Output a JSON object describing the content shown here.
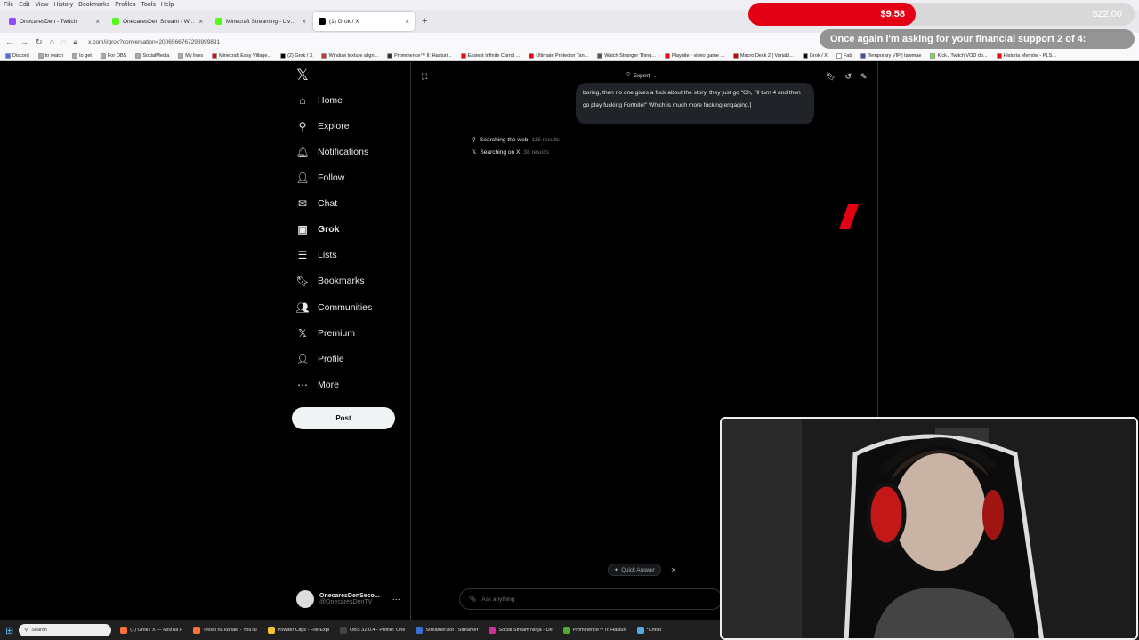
{
  "menubar": [
    "File",
    "Edit",
    "View",
    "History",
    "Bookmarks",
    "Profiles",
    "Tools",
    "Help"
  ],
  "tabs": [
    {
      "label": "OnecaresDen - Twitch",
      "color": "#9146ff",
      "active": false
    },
    {
      "label": "OnecaresDen Stream - Watch Li",
      "color": "#53fc18",
      "active": false
    },
    {
      "label": "Minecraft Streaming - Live Stre",
      "color": "#53fc18",
      "active": false
    },
    {
      "label": "(1) Grok / X",
      "color": "#000000",
      "active": true
    }
  ],
  "new_tab": "+",
  "url": "x.com/i/grok?conversation=2006566767296999891",
  "bookmarks": [
    {
      "label": "Discord",
      "color": "#5865f2"
    },
    {
      "label": "to watch",
      "color": "#aaaaaa"
    },
    {
      "label": "to get",
      "color": "#aaaaaa"
    },
    {
      "label": "For OBS",
      "color": "#aaaaaa"
    },
    {
      "label": "SocialMedia",
      "color": "#aaaaaa"
    },
    {
      "label": "My lives",
      "color": "#aaaaaa"
    },
    {
      "label": "Minecraft Easy Village...",
      "color": "#ff0000"
    },
    {
      "label": "(2) Grok / X",
      "color": "#000000"
    },
    {
      "label": "Window texture align...",
      "color": "#cc3333"
    },
    {
      "label": "Prominence™ II: Hasturi...",
      "color": "#333333"
    },
    {
      "label": "Easiest Infinite Carrot ...",
      "color": "#ff0000"
    },
    {
      "label": "Ultimate Protector Tan...",
      "color": "#ff0000"
    },
    {
      "label": "Watch Stranger Thing...",
      "color": "#555555"
    },
    {
      "label": "Playnite - video game ...",
      "color": "#ff0000"
    },
    {
      "label": "Macro Deck 2 | Variabl...",
      "color": "#cc0000"
    },
    {
      "label": "Grok / X",
      "color": "#000000"
    },
    {
      "label": "Fab",
      "color": "#ffffff"
    },
    {
      "label": "Temporary VIP | tawmae",
      "color": "#3355aa"
    },
    {
      "label": "Kick / Twitch VOD do...",
      "color": "#53fc18"
    },
    {
      "label": "Historia Memów - PLS...",
      "color": "#ff0000"
    }
  ],
  "sidebar": {
    "items": [
      {
        "label": "Home",
        "icon": "home-icon",
        "glyph": "⌂"
      },
      {
        "label": "Explore",
        "icon": "search-icon",
        "glyph": "⚲"
      },
      {
        "label": "Notifications",
        "icon": "bell-icon",
        "glyph": "🔔︎"
      },
      {
        "label": "Follow",
        "icon": "add-person-icon",
        "glyph": "👤︎"
      },
      {
        "label": "Chat",
        "icon": "mail-icon",
        "glyph": "✉"
      },
      {
        "label": "Grok",
        "icon": "grok-icon",
        "glyph": "▣"
      },
      {
        "label": "Lists",
        "icon": "list-icon",
        "glyph": "☰"
      },
      {
        "label": "Bookmarks",
        "icon": "bookmark-icon",
        "glyph": "🔖︎"
      },
      {
        "label": "Communities",
        "icon": "people-icon",
        "glyph": "👥︎"
      },
      {
        "label": "Premium",
        "icon": "x-logo-icon",
        "glyph": "𝕏"
      },
      {
        "label": "Profile",
        "icon": "person-icon",
        "glyph": "👤︎"
      },
      {
        "label": "More",
        "icon": "more-circle-icon",
        "glyph": "⋯"
      }
    ],
    "post_label": "Post",
    "account_name": "OnecaresDenSeco...",
    "account_handle": "@OnecaresDenTV"
  },
  "grok": {
    "mode": "Expert",
    "message": "boring, then no one gives a fuck about the story, they just go \"Oh, I'll turn 4 and then go play fucking Fortnite!\" Which is much more fucking engaging.]",
    "searches": [
      {
        "label": "Searching the web",
        "count": "115 results"
      },
      {
        "label": "Searching on X",
        "count": "38 results"
      }
    ],
    "quick_answer": "Quick Answer",
    "ask_placeholder": "Ask anything"
  },
  "overlay": {
    "goal_current": "$9.58",
    "goal_target": "$22.00",
    "banner": "Once again i'm asking for your financial support 2 of 4:"
  },
  "taskbar": {
    "search": "Search",
    "apps": [
      {
        "label": "(1) Grok / X — Mozilla F",
        "color": "#ff7139"
      },
      {
        "label": "Treści na kanale - YouTu",
        "color": "#ff7139"
      },
      {
        "label": "Powder Clips - File Expl",
        "color": "#f4c430"
      },
      {
        "label": "OBS 32.0.4 - Profile: One",
        "color": "#444444"
      },
      {
        "label": "Streamer.bot - Streamer",
        "color": "#3a6fd8"
      },
      {
        "label": "Social Stream Ninja - De",
        "color": "#cc3399"
      },
      {
        "label": "Prominence™ II: Hasturi",
        "color": "#55aa33"
      },
      {
        "label": "*Christ",
        "color": "#55aadd"
      }
    ]
  },
  "colors": {
    "accent_red": "#e40014",
    "x_bg": "#000000",
    "text": "#e7e9ea",
    "muted": "#71767b"
  }
}
